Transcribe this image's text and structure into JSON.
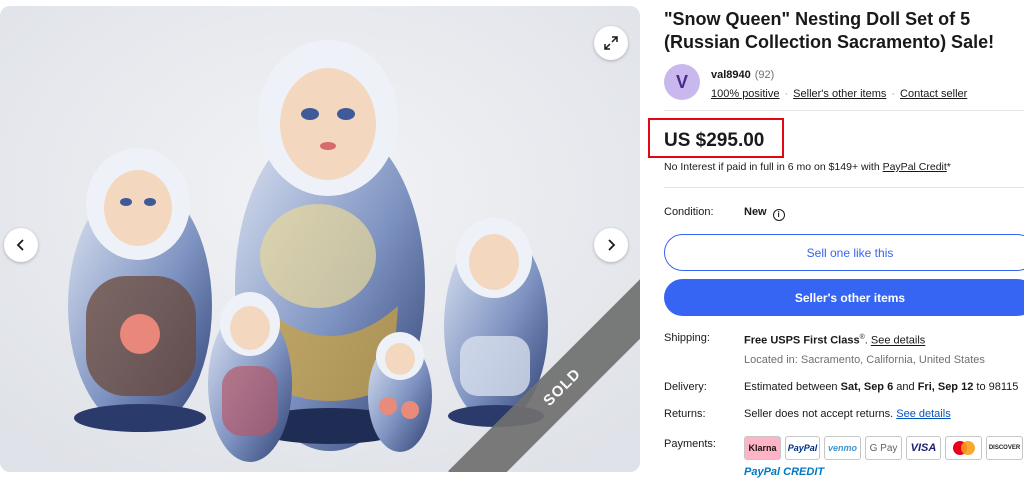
{
  "listing": {
    "title": "\"Snow Queen\" Nesting Doll Set of 5 (Russian Collection Sacramento) Sale!",
    "sold_badge": "SOLD"
  },
  "seller": {
    "avatar_letter": "V",
    "name": "val8940",
    "feedback_count": "(92)",
    "positive": "100% positive",
    "other_items_link": "Seller's other items",
    "contact_link": "Contact seller"
  },
  "price": {
    "amount": "US $295.00",
    "finance_text": "No Interest if paid in full in 6 mo on $149+ with",
    "finance_link": "PayPal Credit",
    "finance_suffix": "*"
  },
  "condition": {
    "label": "Condition:",
    "value": "New"
  },
  "buttons": {
    "sell_like_this": "Sell one like this",
    "sellers_other_items": "Seller's other items"
  },
  "shipping": {
    "label": "Shipping:",
    "free": "Free",
    "method": "USPS First Class",
    "reg": "®",
    "see_details": "See details",
    "location": "Located in: Sacramento, California, United States"
  },
  "delivery": {
    "label": "Delivery:",
    "prefix": "Estimated between",
    "start": "Sat, Sep 6",
    "and": "and",
    "end": "Fri, Sep 12",
    "to": "to 98115"
  },
  "returns": {
    "label": "Returns:",
    "text": "Seller does not accept returns.",
    "see_details": "See details"
  },
  "payments": {
    "label": "Payments:",
    "methods": [
      "Klarna",
      "PayPal",
      "venmo",
      "G Pay",
      "VISA",
      "",
      "DISCOVER"
    ],
    "paypal_credit": [
      "PayPal",
      "CREDIT"
    ]
  },
  "colors": {
    "accent_blue": "#3665f3",
    "highlight_red": "#e30613",
    "avatar_bg": "#c9b8ee"
  }
}
